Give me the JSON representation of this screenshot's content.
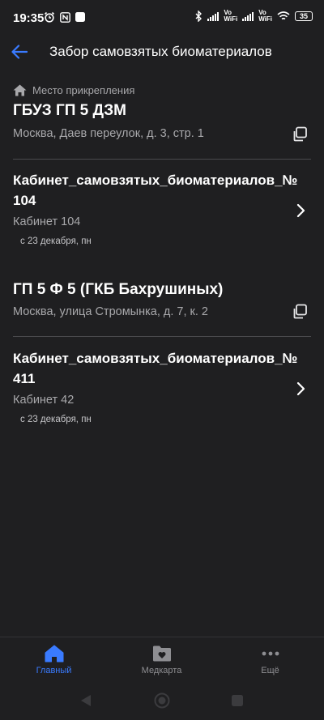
{
  "status_bar": {
    "time": "19:35",
    "vowifi_1": "Vo\nWiFi",
    "vowifi_2": "Vo\nWiFi",
    "battery": "35"
  },
  "header": {
    "title": "Забор самовзятых биоматериалов"
  },
  "attachment": {
    "label": "Место прикрепления",
    "org_name": "ГБУЗ ГП 5 ДЗМ",
    "address": "Москва, Даев переулок, д. 3, стр. 1"
  },
  "cabinets": [
    {
      "title": "Кабинет_самовзятых_биоматериалов_№ 104",
      "subtitle": "Кабинет 104",
      "date": "с 23 декабря, пн"
    },
    {
      "title": "Кабинет_самовзятых_биоматериалов_№ 411",
      "subtitle": "Кабинет 42",
      "date": "с 23 декабря, пн"
    }
  ],
  "second_org": {
    "name": "ГП 5 Ф 5 (ГКБ Бахрушиных)",
    "address": "Москва, улица Стромынка, д. 7, к. 2"
  },
  "bottom_nav": {
    "items": [
      {
        "label": "Главный",
        "icon": "home-icon",
        "active": true
      },
      {
        "label": "Медкарта",
        "icon": "medcard-icon",
        "active": false
      },
      {
        "label": "Ещё",
        "icon": "more-icon",
        "active": false
      }
    ]
  },
  "colors": {
    "background": "#1f1f21",
    "accent": "#3a7bff",
    "secondary_text": "#a8a8ab",
    "divider": "#4a4a4d",
    "inactive_nav": "#8e8e92"
  }
}
